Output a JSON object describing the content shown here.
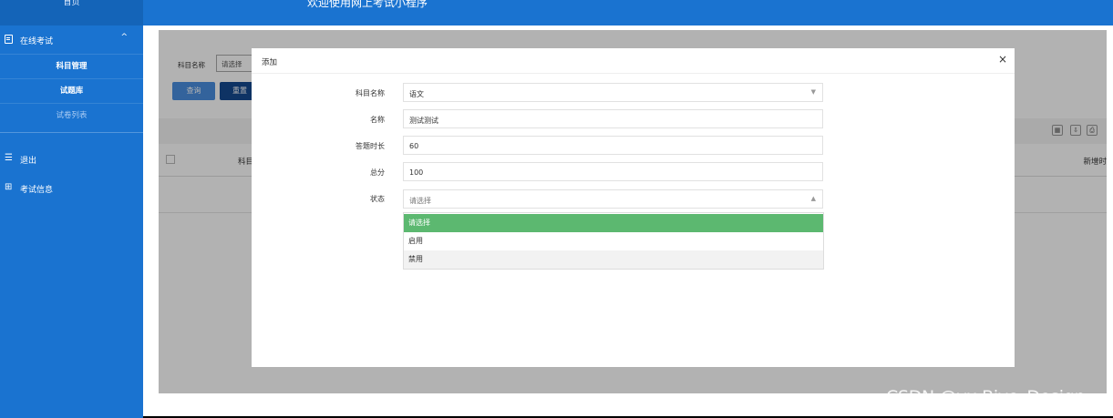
{
  "sidebar": {
    "top_label": "首页",
    "group": {
      "label": "在线考试",
      "chevron": "^"
    },
    "sub_items": [
      {
        "label": "科目管理"
      },
      {
        "label": "试题库"
      },
      {
        "label": "试卷列表"
      }
    ],
    "logout": {
      "icon": "☰",
      "label": "退出"
    },
    "exam_info": {
      "icon": "⊞",
      "label": "考试信息"
    }
  },
  "header": {
    "title": "欢迎使用网上考试小程序"
  },
  "filter": {
    "subject_label": "科目名称",
    "subject_placeholder": "请选择",
    "query_button": "查询",
    "reset_button": "重置"
  },
  "table": {
    "columns": [
      "科目",
      "新增时"
    ],
    "tools": [
      "▦",
      "⇩",
      "⎙"
    ]
  },
  "dialog": {
    "title": "添加",
    "close": "×",
    "fields": [
      {
        "label": "科目名称",
        "value": "语文"
      },
      {
        "label": "名称",
        "value": "测试测试"
      },
      {
        "label": "答题时长",
        "value": "60"
      },
      {
        "label": "总分",
        "value": "100"
      },
      {
        "label": "状态",
        "value": "请选择"
      }
    ],
    "status_options": [
      "请选择",
      "启用",
      "禁用"
    ],
    "selected_option": "请选择"
  },
  "watermark": "CSDN @vx-Biye_Design",
  "colors": {
    "sidebar": "#1a73d0",
    "header": "#1a73d0",
    "option_selected": "#5cb870",
    "reset_button": "#154a90"
  }
}
